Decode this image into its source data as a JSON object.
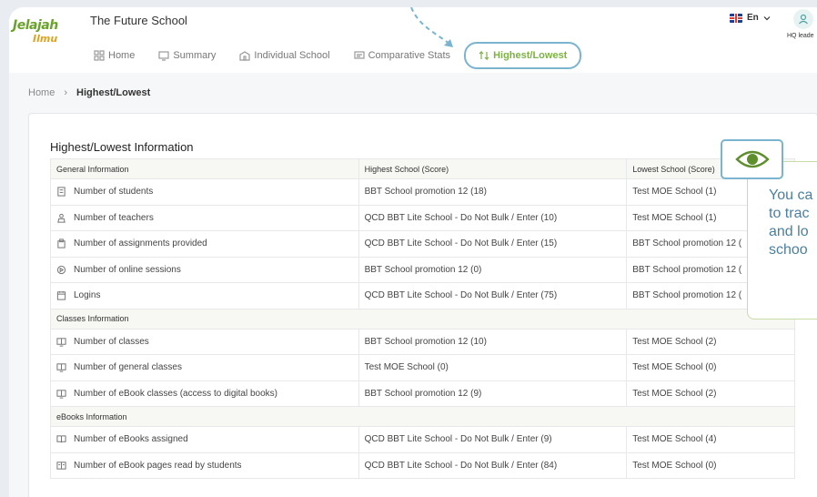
{
  "brand": {
    "logo_top": "Jelajah",
    "logo_bottom": "Ilmu"
  },
  "header": {
    "school_name": "The Future School",
    "language": "En",
    "user_role": "HQ leade"
  },
  "nav": [
    {
      "label": "Home",
      "icon": "grid-icon"
    },
    {
      "label": "Summary",
      "icon": "monitor-icon"
    },
    {
      "label": "Individual School",
      "icon": "school-icon"
    },
    {
      "label": "Comparative Stats",
      "icon": "chat-icon"
    },
    {
      "label": "Highest/Lowest",
      "icon": "sort-icon",
      "active": true
    }
  ],
  "breadcrumb": {
    "home": "Home",
    "current": "Highest/Lowest"
  },
  "card": {
    "title": "Highest/Lowest Information"
  },
  "table": {
    "headers": [
      "General Information",
      "Highest School (Score)",
      "Lowest School (Score)"
    ],
    "groups": [
      {
        "rows": [
          {
            "metric": "Number of students",
            "icon": "student-icon",
            "highest": "BBT School promotion 12 (18)",
            "lowest": "Test MOE School (1)"
          },
          {
            "metric": "Number of teachers",
            "icon": "teacher-icon",
            "highest": "QCD BBT Lite School - Do Not Bulk / Enter (10)",
            "lowest": "Test MOE School (1)"
          },
          {
            "metric": "Number of assignments provided",
            "icon": "assignment-icon",
            "highest": "QCD BBT Lite School - Do Not Bulk / Enter (15)",
            "lowest": "BBT School promotion 12 ("
          },
          {
            "metric": "Number of online sessions",
            "icon": "session-icon",
            "highest": "BBT School promotion 12 (0)",
            "lowest": "BBT School promotion 12 ("
          },
          {
            "metric": "Logins",
            "icon": "calendar-icon",
            "highest": "QCD BBT Lite School - Do Not Bulk / Enter (75)",
            "lowest": "BBT School promotion 12 ("
          }
        ]
      },
      {
        "title": "Classes Information",
        "rows": [
          {
            "metric": "Number of classes",
            "icon": "class-icon",
            "highest": "BBT School promotion 12 (10)",
            "lowest": "Test MOE School (2)"
          },
          {
            "metric": "Number of general classes",
            "icon": "class-icon",
            "highest": "Test MOE School (0)",
            "lowest": "Test MOE School (0)"
          },
          {
            "metric": "Number of eBook classes (access to digital books)",
            "icon": "class-icon",
            "highest": "BBT School promotion 12 (9)",
            "lowest": "Test MOE School (2)"
          }
        ]
      },
      {
        "title": "eBooks Information",
        "rows": [
          {
            "metric": "Number of eBooks assigned",
            "icon": "book-icon",
            "highest": "QCD BBT Lite School - Do Not Bulk / Enter (9)",
            "lowest": "Test MOE School (4)"
          },
          {
            "metric": "Number of eBook pages read by students",
            "icon": "pages-icon",
            "highest": "QCD BBT Lite School - Do Not Bulk / Enter (84)",
            "lowest": "Test MOE School (0)"
          }
        ]
      }
    ]
  },
  "tooltip": {
    "lines": [
      "You ca",
      "to trac",
      "and lo",
      "schoo"
    ]
  },
  "colors": {
    "accent_green": "#7cb342",
    "highlight_blue": "#7ab4cf",
    "tooltip_text": "#4b7fa0"
  }
}
